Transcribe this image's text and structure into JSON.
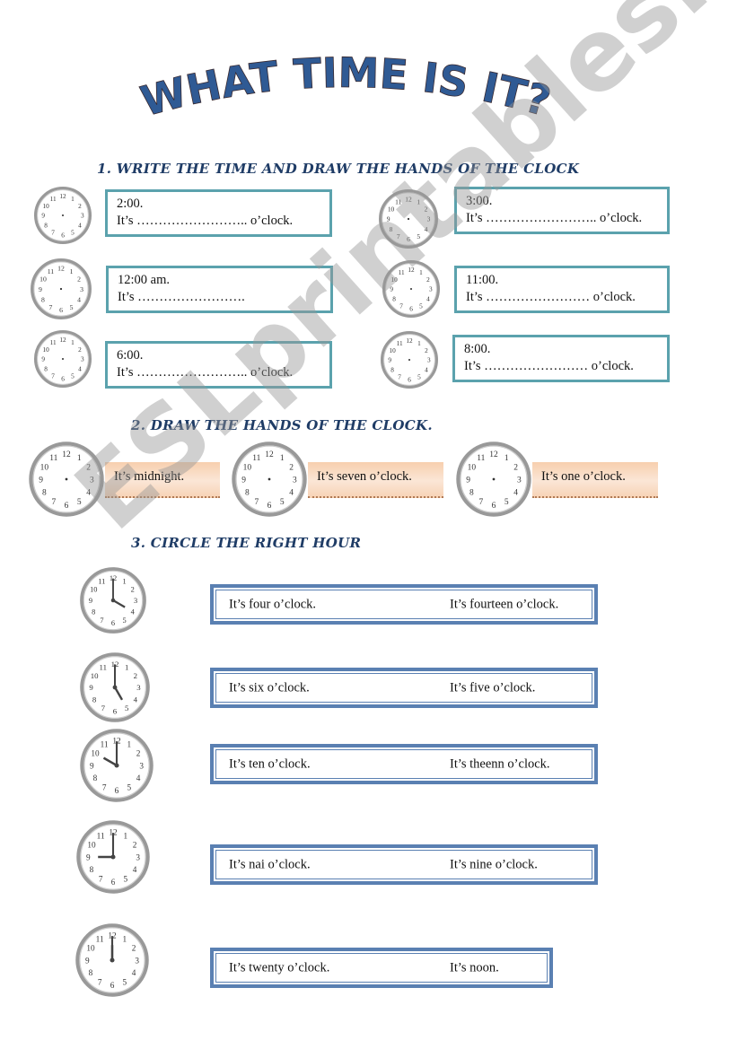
{
  "title": "WHAT TIME IS IT?",
  "watermark": "ESLprintables.com",
  "section1": {
    "heading": "1.  WRITE THE TIME AND DRAW THE HANDS OF THE CLOCK",
    "items": [
      {
        "time": "2:00.",
        "line": "It’s …………………….. o’clock."
      },
      {
        "time": "3:00.",
        "line": "It’s …………………….. o’clock."
      },
      {
        "time": "12:00 am.",
        "line": "It’s ……………………."
      },
      {
        "time": "11:00.",
        "line": "It’s …………………… o’clock."
      },
      {
        "time": "6:00.",
        "line": "It’s …………………….. o’clock."
      },
      {
        "time": "8:00.",
        "line": "It’s …………………… o’clock."
      }
    ]
  },
  "section2": {
    "heading": "2.  DRAW THE HANDS OF THE CLOCK.",
    "items": [
      "It’s midnight.",
      "It’s seven o’clock.",
      "It’s one o’clock."
    ]
  },
  "section3": {
    "heading": "3.  CIRCLE THE RIGHT HOUR",
    "items": [
      {
        "clock_time": "4:00",
        "left": "It’s four o’clock.",
        "right": "It’s fourteen o’clock."
      },
      {
        "clock_time": "5:00",
        "left": "It’s six o’clock.",
        "right": "It’s five o’clock."
      },
      {
        "clock_time": "10:00",
        "left": "It’s ten o’clock.",
        "right": "It’s theenn o’clock."
      },
      {
        "clock_time": "9:00",
        "left": "It’s nai o’clock.",
        "right": "It’s nine o’clock."
      },
      {
        "clock_time": "12:00",
        "left": "It’s twenty o’clock.",
        "right": "It’s noon."
      }
    ]
  },
  "colors": {
    "title": "#2f5a94",
    "heading": "#1f3c66",
    "box1_border": "#5ba2ad",
    "box3_border": "#5a80b2"
  }
}
